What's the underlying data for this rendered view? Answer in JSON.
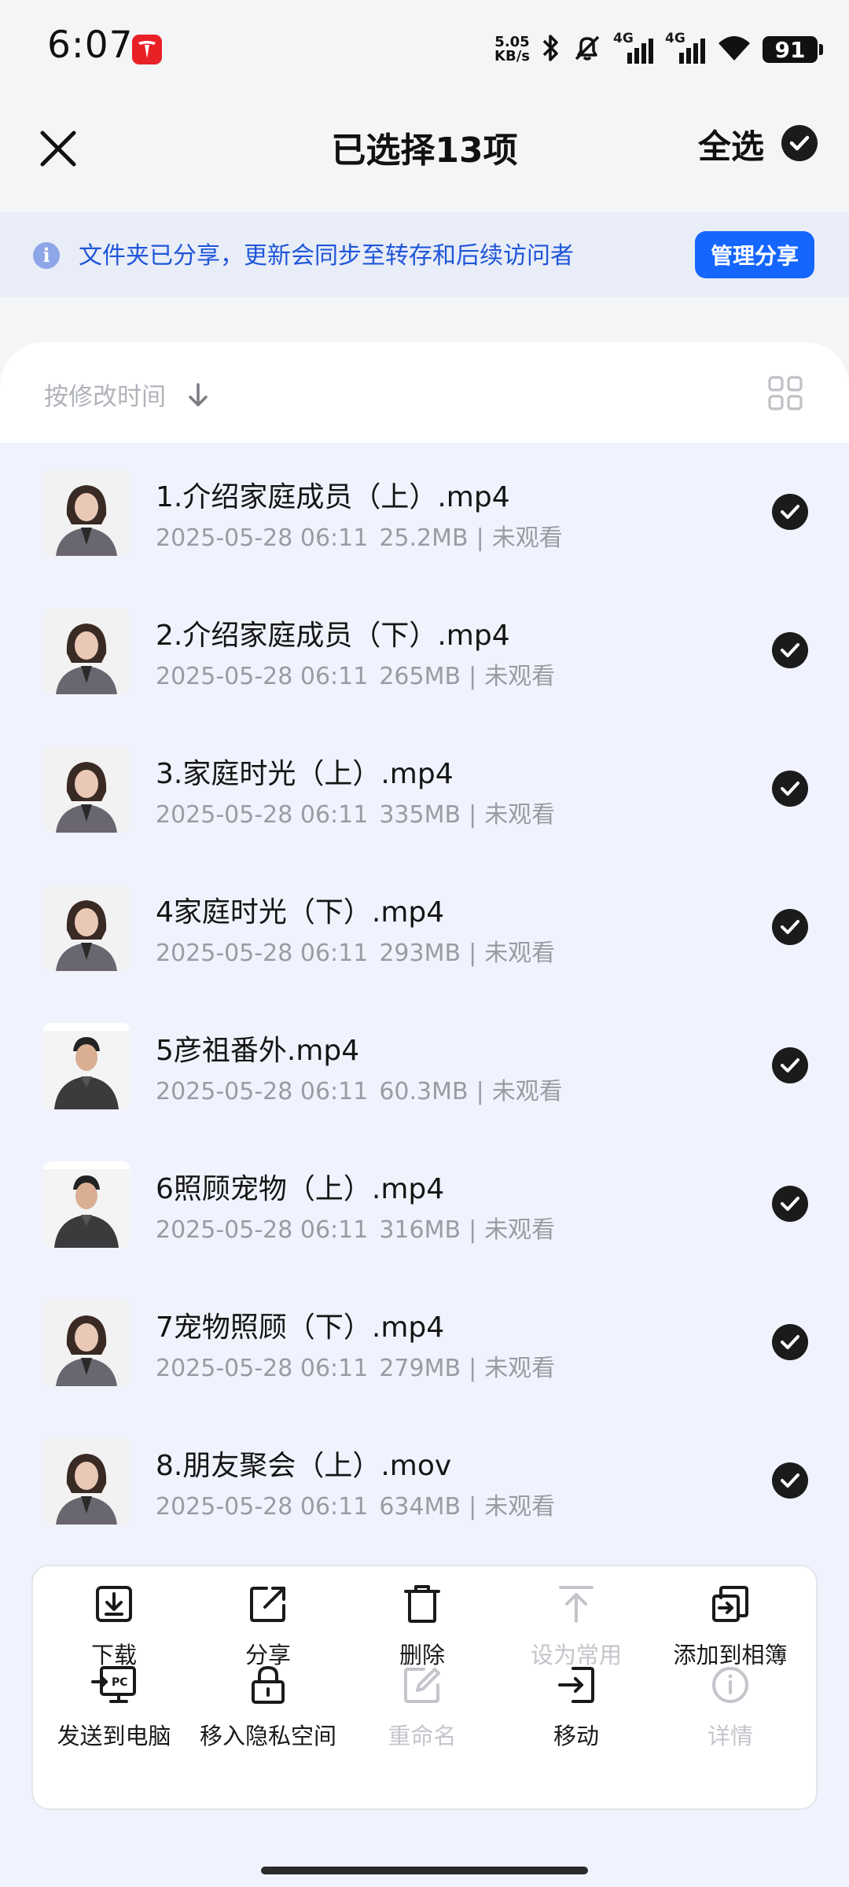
{
  "status_bar": {
    "time": "6:07",
    "net_speed_value": "5.05",
    "net_speed_unit": "KB/s",
    "signal_1": "4G",
    "signal_2": "4G",
    "battery": "91"
  },
  "header": {
    "title": "已选择13项",
    "select_all_label": "全选"
  },
  "notice": {
    "text": "文件夹已分享，更新会同步至转存和后续访问者",
    "button": "管理分享"
  },
  "sort": {
    "label": "按修改时间"
  },
  "files": [
    {
      "name": "1.介绍家庭成员（上）.mp4",
      "date": "2025-05-28 06:11",
      "size": "25.2MB",
      "status": "未观看",
      "thumb": "woman"
    },
    {
      "name": "2.介绍家庭成员（下）.mp4",
      "date": "2025-05-28 06:11",
      "size": "265MB",
      "status": "未观看",
      "thumb": "woman"
    },
    {
      "name": "3.家庭时光（上）.mp4",
      "date": "2025-05-28 06:11",
      "size": "335MB",
      "status": "未观看",
      "thumb": "woman"
    },
    {
      "name": "4家庭时光（下）.mp4",
      "date": "2025-05-28 06:11",
      "size": "293MB",
      "status": "未观看",
      "thumb": "woman"
    },
    {
      "name": "5彦祖番外.mp4",
      "date": "2025-05-28 06:11",
      "size": "60.3MB",
      "status": "未观看",
      "thumb": "man"
    },
    {
      "name": "6照顾宠物（上）.mp4",
      "date": "2025-05-28 06:11",
      "size": "316MB",
      "status": "未观看",
      "thumb": "man"
    },
    {
      "name": "7宠物照顾（下）.mp4",
      "date": "2025-05-28 06:11",
      "size": "279MB",
      "status": "未观看",
      "thumb": "woman"
    },
    {
      "name": "8.朋友聚会（上）.mov",
      "date": "2025-05-28 06:11",
      "size": "634MB",
      "status": "未观看",
      "thumb": "woman"
    }
  ],
  "actions": [
    {
      "label": "下载",
      "icon": "download-icon",
      "enabled": true
    },
    {
      "label": "分享",
      "icon": "share-icon",
      "enabled": true
    },
    {
      "label": "删除",
      "icon": "delete-icon",
      "enabled": true
    },
    {
      "label": "设为常用",
      "icon": "pin-top-icon",
      "enabled": false
    },
    {
      "label": "添加到相簿",
      "icon": "add-to-album-icon",
      "enabled": true
    },
    {
      "label": "发送到电脑",
      "icon": "send-to-pc-icon",
      "enabled": true
    },
    {
      "label": "移入隐私空间",
      "icon": "lock-icon",
      "enabled": true
    },
    {
      "label": "重命名",
      "icon": "rename-icon",
      "enabled": false
    },
    {
      "label": "移动",
      "icon": "move-icon",
      "enabled": true
    },
    {
      "label": "详情",
      "icon": "info-icon",
      "enabled": false
    }
  ],
  "colors": {
    "accent": "#1566ff",
    "notice_text": "#1e56d9",
    "notice_bg": "#e9edf8",
    "list_bg": "#f0f3fd",
    "disabled": "#c3c5ca"
  }
}
